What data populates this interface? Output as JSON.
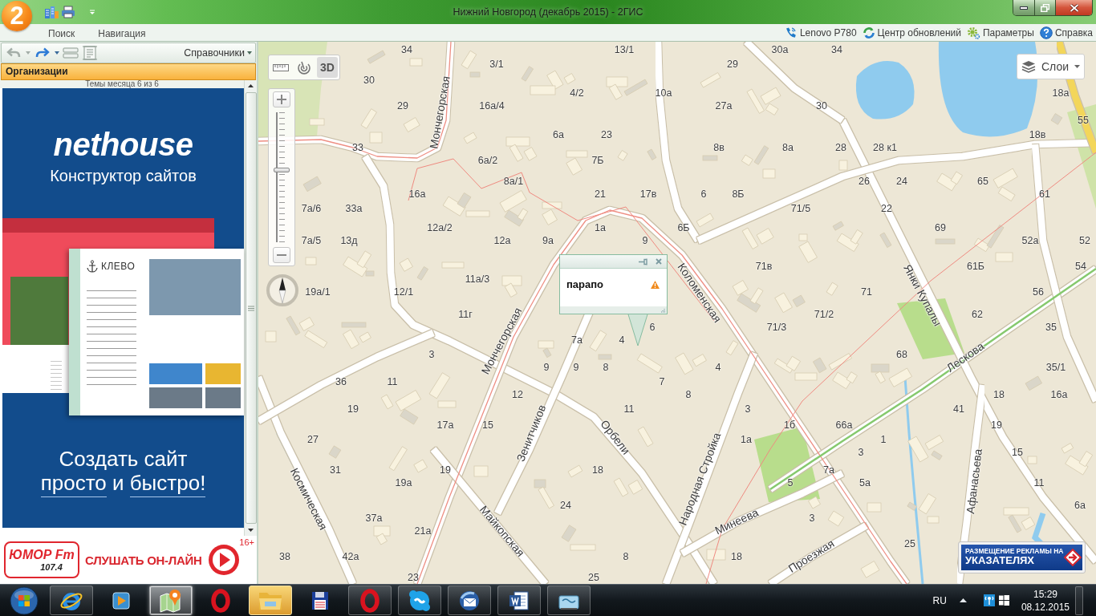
{
  "window": {
    "title": "Нижний Новгород (декабрь 2015) - 2ГИС",
    "app_logo": "2"
  },
  "ribbon": {
    "tabs": [
      "Поиск",
      "Навигация"
    ],
    "links": [
      {
        "kind": "phone",
        "label": "Lenovo P780"
      },
      {
        "kind": "update",
        "label": "Центр обновлений"
      },
      {
        "kind": "settings",
        "label": "Параметры"
      },
      {
        "kind": "help",
        "label": "Справка"
      }
    ]
  },
  "sidebar": {
    "nav_buttons": [
      {
        "kind": "back",
        "disabled": true
      },
      {
        "kind": "forward",
        "disabled": false
      }
    ],
    "catalog_menu": "Справочники",
    "section": "Организации",
    "carousel_caption": "Темы месяца 6 из 6",
    "ad": {
      "logo": "nethouse",
      "tagline": "Конструктор сайтов",
      "preview_logo": "КЛЕВО",
      "headline": "Создать сайт",
      "slogan": [
        {
          "text": "просто",
          "underlined": true
        },
        {
          "text": "и",
          "underlined": false
        },
        {
          "text": "быстро!",
          "underlined": true
        }
      ]
    },
    "radio_ad": {
      "logo": "ЮМОР Fm",
      "frequency": "107.4",
      "call_to_action": "СЛУШАТЬ ОН-ЛАЙН",
      "age_rating": "16+"
    }
  },
  "map": {
    "tools": [
      {
        "kind": "ruler",
        "selected": false
      },
      {
        "kind": "radar",
        "selected": false
      },
      {
        "kind": "toggle",
        "label": "3D",
        "selected": true
      }
    ],
    "zoom": {
      "level": 0.55
    },
    "layers_button": "Слои",
    "streets": [
      "Мончегорская",
      "Мончегорская",
      "Зенитчиков",
      "Орбели",
      "Коломенская",
      "Янки Купалы",
      "Лескова",
      "Народная Стройка",
      "Майкопская",
      "Космическая",
      "Минеева",
      "Проезжая",
      "Афанасьева"
    ],
    "house_numbers": [
      "34",
      "13/1",
      "30а",
      "34",
      "3/1",
      "29",
      "30",
      "4/2",
      "10а",
      "18а",
      "29",
      "16а/4",
      "27а",
      "30",
      "55",
      "6а",
      "23",
      "18в",
      "33",
      "8в",
      "8а",
      "28",
      "28 к1",
      "6а/2",
      "7Б",
      "8а/1",
      "26",
      "24",
      "65",
      "16а",
      "21",
      "17в",
      "6",
      "8Б",
      "61",
      "7а/6",
      "33а",
      "71/5",
      "22",
      "12а/2",
      "1а",
      "6Б",
      "69",
      "7а/5",
      "13д",
      "12а",
      "9а",
      "9",
      "52а",
      "52",
      "71в",
      "61Б",
      "54",
      "11а/3",
      "19а/1",
      "12/1",
      "71",
      "56",
      "11г",
      "71/2",
      "62",
      "6",
      "71/3",
      "35",
      "7а",
      "4",
      "3",
      "68",
      "9",
      "9",
      "8",
      "4",
      "35/1",
      "36",
      "11",
      "7",
      "12",
      "8",
      "18",
      "16а",
      "19",
      "11",
      "3",
      "41",
      "17а",
      "15",
      "1б",
      "66а",
      "19",
      "27",
      "1а",
      "1",
      "3",
      "15",
      "31",
      "19",
      "18",
      "7а",
      "19а",
      "5",
      "5а",
      "11",
      "24",
      "6а",
      "37а",
      "3",
      "21а",
      "25",
      "38",
      "42а",
      "8",
      "18",
      "23",
      "25"
    ],
    "popup": {
      "text": "парапо",
      "warning": true
    },
    "sign_ad": {
      "line_1": "РАЗМЕЩЕНИЕ РЕКЛАМЫ НА",
      "line_2": "УКАЗАТЕЛЯХ"
    }
  },
  "taskbar": {
    "apps": [
      {
        "kind": "explorer",
        "running": true,
        "selected": false,
        "flashing": false
      },
      {
        "kind": "player",
        "running": false,
        "selected": false,
        "flashing": false
      },
      {
        "kind": "maps",
        "running": true,
        "selected": true,
        "flashing": false
      },
      {
        "kind": "ring",
        "running": false,
        "selected": false,
        "flashing": false
      },
      {
        "kind": "folder",
        "running": true,
        "selected": false,
        "flashing": true
      },
      {
        "kind": "floppy",
        "running": false,
        "selected": false,
        "flashing": false
      },
      {
        "kind": "ring",
        "running": true,
        "selected": false,
        "flashing": false
      },
      {
        "kind": "chat",
        "running": true,
        "selected": false,
        "flashing": false
      },
      {
        "kind": "mail",
        "running": true,
        "selected": false,
        "flashing": false
      },
      {
        "kind": "document",
        "running": true,
        "selected": false,
        "flashing": false
      },
      {
        "kind": "scanner",
        "running": true,
        "selected": false,
        "flashing": false
      }
    ],
    "language": "RU",
    "time": "15:29",
    "date": "08.12.2015"
  }
}
